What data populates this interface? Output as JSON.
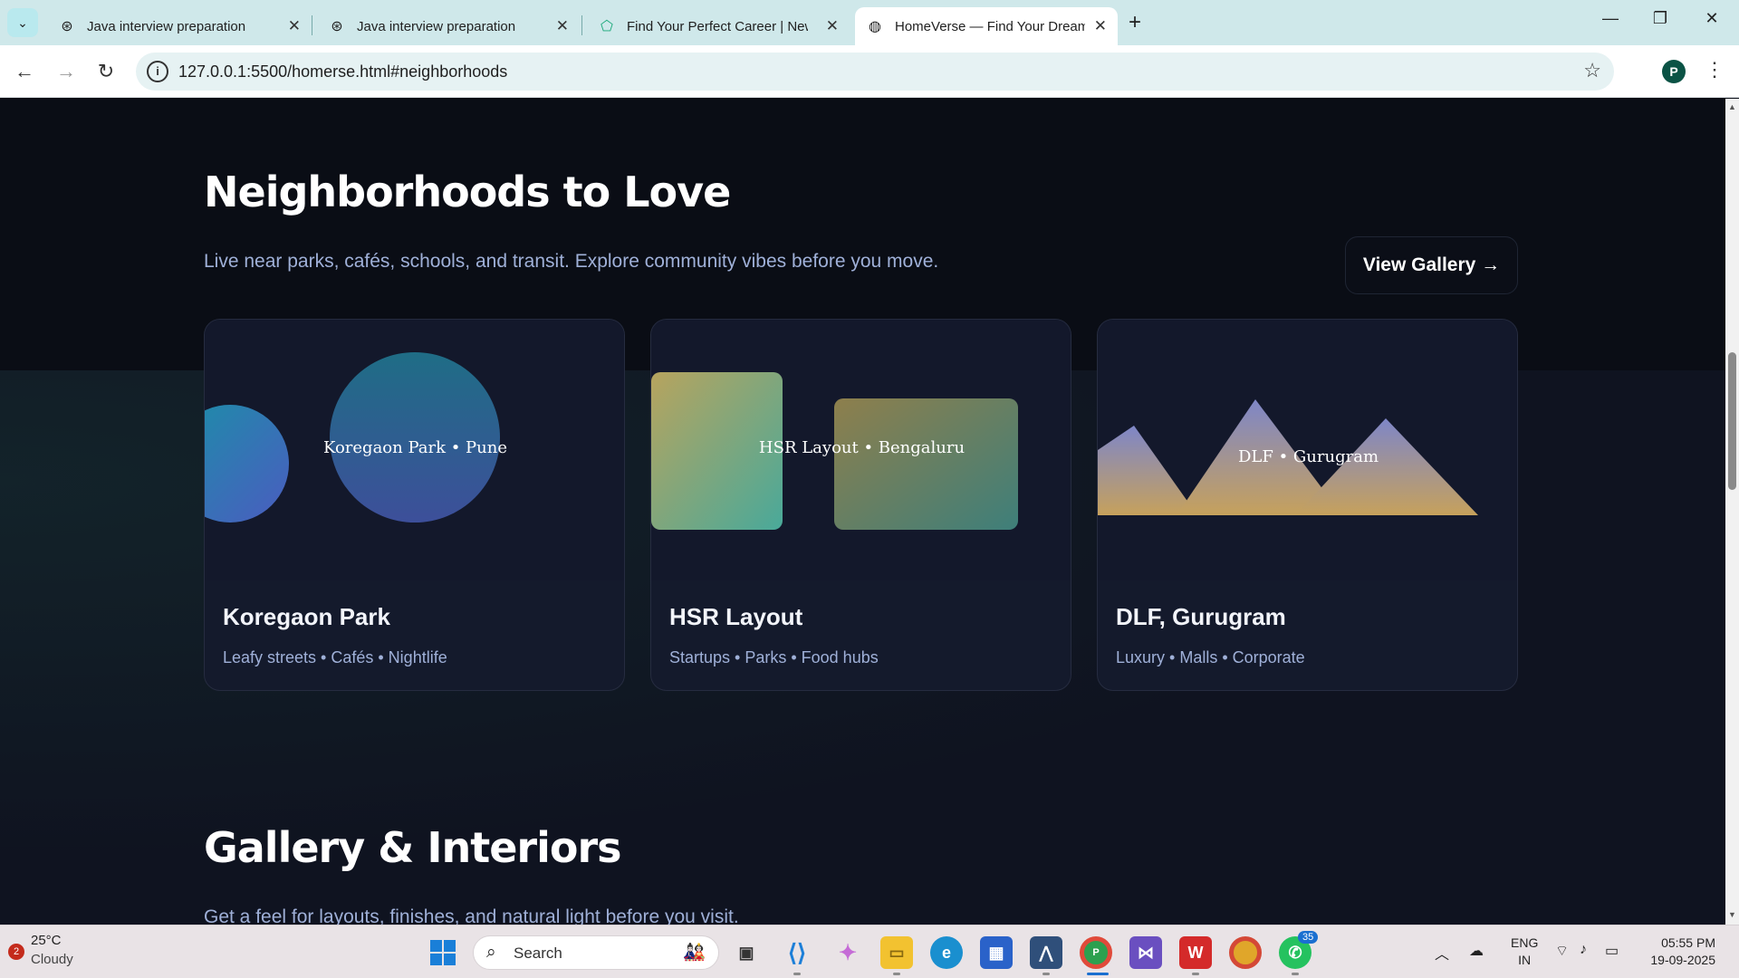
{
  "browser": {
    "tabs": [
      {
        "label": "Java interview preparation",
        "icon": "openai-icon"
      },
      {
        "label": "Java interview preparation",
        "icon": "openai-icon"
      },
      {
        "label": "Find Your Perfect Career | New D",
        "icon": "career-site-icon"
      },
      {
        "label": "HomeVerse — Find Your Dream",
        "icon": "globe-icon"
      }
    ],
    "url": "127.0.0.1:5500/homerse.html#neighborhoods",
    "profile_initial": "P"
  },
  "page": {
    "neighborhoods": {
      "title": "Neighborhoods to Love",
      "subtitle": "Live near parks, cafés, schools, and transit. Explore community vibes before you move.",
      "gallery_button": "View Gallery →",
      "cards": [
        {
          "art_label": "Koregaon Park • Pune",
          "name": "Koregaon Park",
          "tags": "Leafy streets • Cafés • Nightlife"
        },
        {
          "art_label": "HSR Layout • Bengaluru",
          "name": "HSR Layout",
          "tags": "Startups • Parks • Food hubs"
        },
        {
          "art_label": "DLF • Gurugram",
          "name": "DLF, Gurugram",
          "tags": "Luxury • Malls • Corporate"
        }
      ]
    },
    "gallery": {
      "title": "Gallery & Interiors",
      "subtitle": "Get a feel for layouts, finishes, and natural light before you visit."
    }
  },
  "taskbar": {
    "weather_badge": "2",
    "temperature": "25°C",
    "condition": "Cloudy",
    "search_placeholder": "Search",
    "whatsapp_badge": "35",
    "chrome_profile_badge": "P",
    "language": "ENG",
    "region": "IN",
    "time": "05:55 PM",
    "date": "19-09-2025"
  }
}
